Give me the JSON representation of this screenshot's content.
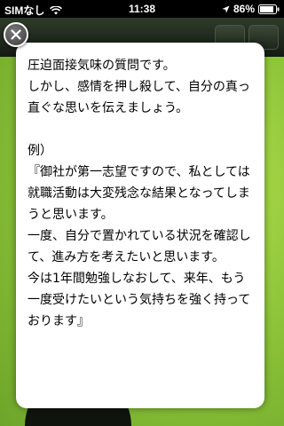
{
  "status_bar": {
    "carrier": "SIMなし",
    "time": "11:38",
    "battery": "86%"
  },
  "icons": {
    "wifi": "wifi-icon",
    "location": "location-arrow-icon",
    "battery": "battery-icon",
    "close": "close-icon"
  },
  "popup": {
    "text": "圧迫面接気味の質問です。\nしかし、感情を押し殺して、自分の真っ直ぐな思いを伝えましょう。\n\n例）\n『御社が第一志望ですので、私としては就職活動は大変残念な結果となってしまうと思います。\n一度、自分で置かれている状況を確認して、進み方を考えたいと思います。\n今は1年間勉強しなおして、来年、もう一度受けたいという気持ちを強く持っております』"
  },
  "colors": {
    "background_green": "#8fc43a",
    "status_bar": "#000000",
    "card": "#ffffff"
  }
}
